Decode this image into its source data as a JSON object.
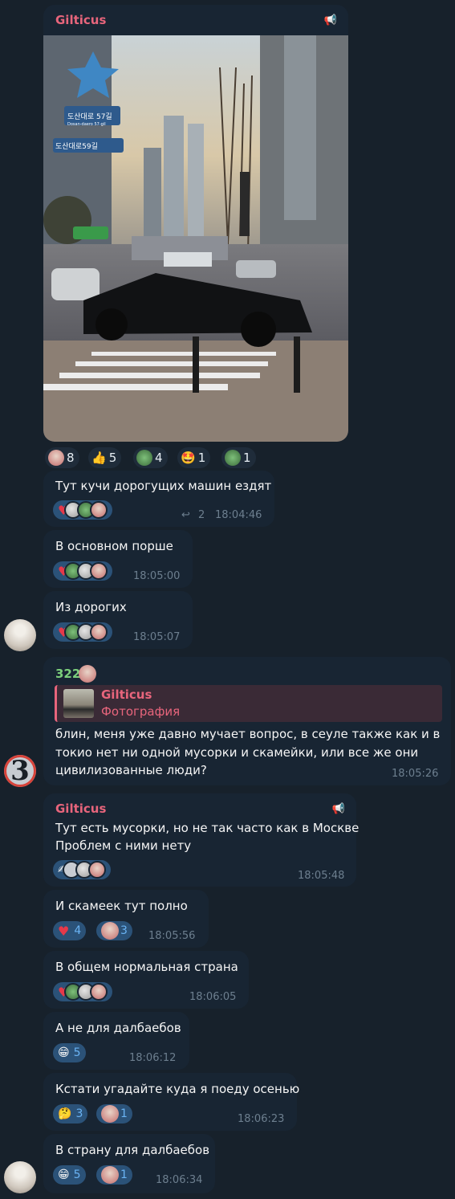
{
  "post": {
    "author": "Gilticus",
    "photo_sign_street": "도산대로 57길",
    "photo_sign_small": "Dosan-daero 57-gil",
    "photo_sign_street2": "도산대로59길",
    "reactions": [
      {
        "icon": "face-sticker",
        "count": "8"
      },
      {
        "icon": "thumbs-up",
        "count": "5"
      },
      {
        "icon": "pepe-sticker",
        "count": "4"
      },
      {
        "icon": "star-struck",
        "count": "1"
      },
      {
        "icon": "pepe-green",
        "count": "1"
      }
    ]
  },
  "messages": [
    {
      "text": "Тут кучи дорогущих машин ездят",
      "time": "18:04:46",
      "replies": "2"
    },
    {
      "text": "В основном порше",
      "time": "18:05:00"
    },
    {
      "text": "Из дорогих",
      "time": "18:05:07"
    },
    {
      "sender": "322",
      "reply_author": "Gilticus",
      "reply_preview": "Фотография",
      "text_lines": [
        "блин, меня уже давно мучает вопрос, в сеуле также как и в",
        "токио нет ни одной мусорки и скамейки, или все же они",
        "цивилизованные люди?"
      ],
      "time": "18:05:26",
      "avatar_letter": "3"
    },
    {
      "author": "Gilticus",
      "text_lines": [
        "Тут есть мусорки, но не так часто как в Москве",
        "Проблем с ними нету"
      ],
      "time": "18:05:48"
    },
    {
      "text": "И скамеек тут полно",
      "time": "18:05:56",
      "r1": "4",
      "r2": "3"
    },
    {
      "text": "В общем нормальная страна",
      "time": "18:06:05"
    },
    {
      "text": "А не для далбаебов",
      "time": "18:06:12",
      "r1": "5"
    },
    {
      "text": "Кстати угадайте куда я поеду осенью",
      "time": "18:06:23",
      "r1": "3",
      "r2": "1"
    },
    {
      "text": "В страну для далбаебов",
      "time": "18:06:34",
      "r1": "5",
      "r2": "1"
    }
  ],
  "colors": {
    "bg": "#17212b",
    "bubble": "#182533",
    "accent": "#e8657c",
    "time": "#6d7f8f"
  }
}
